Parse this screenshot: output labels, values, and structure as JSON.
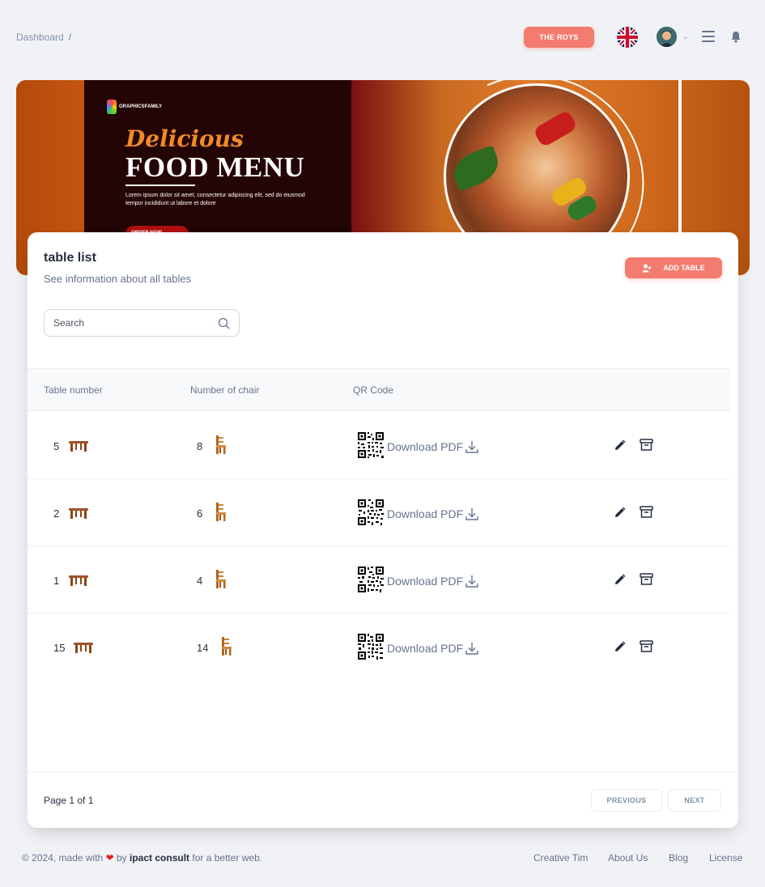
{
  "breadcrumb": {
    "root": "Dashboard",
    "separator": "/"
  },
  "header": {
    "brand_button": "THE ROYS",
    "language_flag": "uk-flag-icon"
  },
  "banner": {
    "logo_text": "GRAPHICSFAMILY",
    "script_title": "Delicious",
    "title": "FOOD MENU",
    "body": "Lorem ipsum dolor sit amet, consectetur adipiscing elit, sed do eiusmod tempor incididunt ut labore et dolore",
    "cta": "ORDER NOW"
  },
  "card": {
    "title": "table list",
    "subtitle": "See information about all tables",
    "add_button": "ADD TABLE",
    "search_placeholder": "Search",
    "columns": [
      "Table number",
      "Number of chair",
      "QR Code",
      ""
    ],
    "rows": [
      {
        "table": "5",
        "chairs": "8",
        "download": "Download PDF"
      },
      {
        "table": "2",
        "chairs": "6",
        "download": "Download PDF"
      },
      {
        "table": "1",
        "chairs": "4",
        "download": "Download PDF"
      },
      {
        "table": "15",
        "chairs": "14",
        "download": "Download PDF"
      }
    ],
    "pagination": {
      "info": "Page 1 of 1",
      "previous": "PREVIOUS",
      "next": "NEXT"
    }
  },
  "footer": {
    "prefix": "© 2024, made with",
    "by": "by",
    "company": "ipact consult",
    "suffix": "for a better web.",
    "links": [
      "Creative Tim",
      "About Us",
      "Blog",
      "License"
    ]
  },
  "colors": {
    "accent": "#f47b70",
    "text_dark": "#252f40",
    "text_muted": "#67748e",
    "background": "#f0f2f5"
  }
}
